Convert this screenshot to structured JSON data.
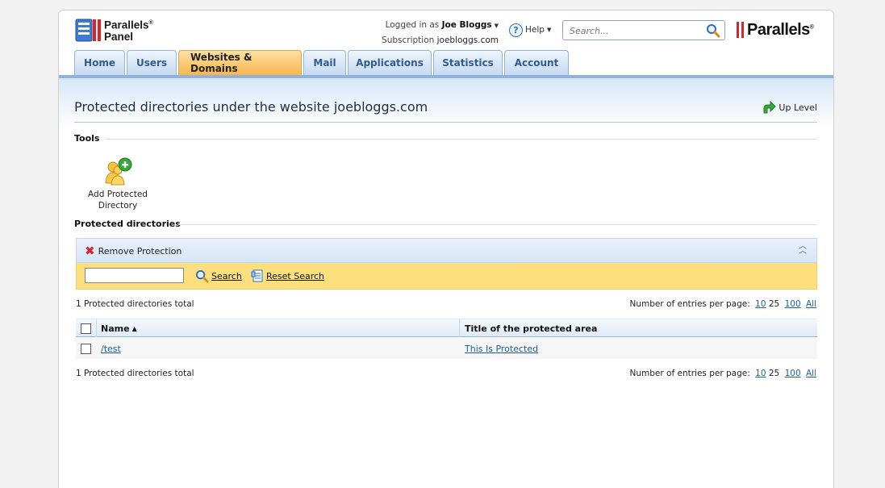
{
  "header": {
    "logo_line1": "Parallels",
    "logo_line2": "Panel",
    "logged_in_prefix": "Logged in as",
    "user_name": "Joe Bloggs",
    "subscription_prefix": "Subscription",
    "subscription_domain": "joebloggs.com",
    "help_label": "Help",
    "search_placeholder": "Search...",
    "brand": "Parallels"
  },
  "tabs": [
    {
      "label": "Home",
      "active": false
    },
    {
      "label": "Users",
      "active": false
    },
    {
      "label": "Websites & Domains",
      "active": true
    },
    {
      "label": "Mail",
      "active": false
    },
    {
      "label": "Applications",
      "active": false
    },
    {
      "label": "Statistics",
      "active": false
    },
    {
      "label": "Account",
      "active": false
    }
  ],
  "page": {
    "title": "Protected directories under the website joebloggs.com",
    "up_level_label": "Up Level"
  },
  "tools": {
    "heading": "Tools",
    "add_label_line1": "Add Protected",
    "add_label_line2": "Directory"
  },
  "list": {
    "heading": "Protected directories",
    "remove_label": "Remove Protection",
    "search_label": "Search",
    "reset_label": "Reset Search",
    "total_text": "1 Protected directories total",
    "per_page_label": "Number of entries per page:",
    "per_page_options": [
      "10",
      "25",
      "100",
      "All"
    ],
    "columns": [
      "Name",
      "Title of the protected area"
    ],
    "rows": [
      {
        "name": "/test",
        "title": "This Is Protected"
      }
    ]
  },
  "colors": {
    "active_tab": "#f7b64c",
    "tab": "#c6daf2",
    "filter_bar": "#fde07d",
    "link": "#1d5fa0",
    "brand_red": "#d6262c"
  }
}
